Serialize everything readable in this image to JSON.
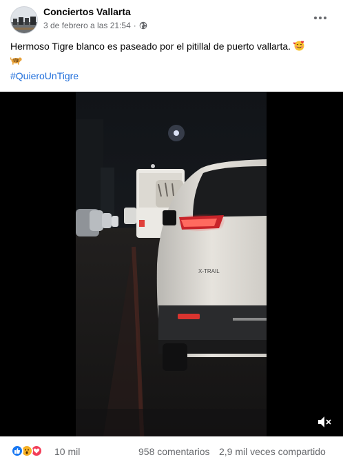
{
  "post": {
    "page_name": "Conciertos Vallarta",
    "timestamp": "3 de febrero a las 21:54",
    "separator": "·",
    "audience_icon": "globe-icon",
    "more_icon": "more-options-icon",
    "caption": "Hermoso Tigre blanco es paseado por el pitillal de puerto vallarta.",
    "caption_emojis": [
      "smiling-face-with-hearts-emoji",
      "tiger-emoji"
    ],
    "hashtag": "#QuieroUnTigre"
  },
  "video": {
    "car_badge": "X-TRAIL",
    "mute_icon": "muted-speaker-icon"
  },
  "footer": {
    "reaction_icons": [
      "like-icon",
      "wow-icon",
      "love-icon"
    ],
    "reaction_count": "10 mil",
    "comments": "958 comentarios",
    "shares": "2,9 mil veces compartido"
  },
  "colors": {
    "link": "#216fdb",
    "secondary_text": "#65676b",
    "like": "#1877f2",
    "love": "#f33e58",
    "wow": "#f7b125"
  }
}
